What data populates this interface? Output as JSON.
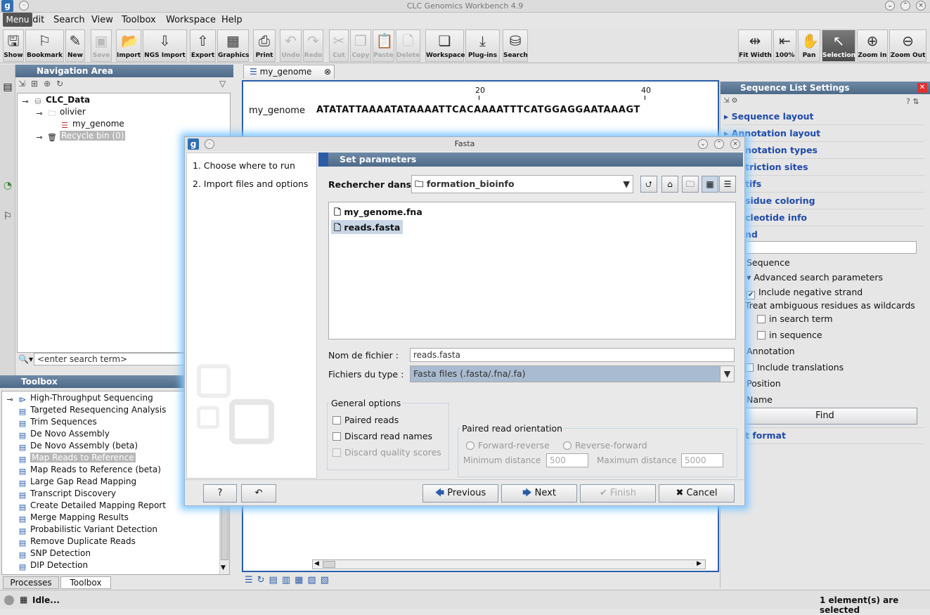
{
  "app": {
    "title": "CLC Genomics Workbench 4.9",
    "logo": "g",
    "menu_tooltip": "Menu"
  },
  "menubar": [
    "Edit",
    "Search",
    "View",
    "Toolbox",
    "Workspace",
    "Help"
  ],
  "toolbar": {
    "left": [
      {
        "label": "Show",
        "icon": "show-icon"
      },
      {
        "label": "Bookmark",
        "icon": "bookmark-icon"
      },
      {
        "label": "New",
        "icon": "new-icon"
      },
      {
        "label": "Save",
        "icon": "save-icon",
        "disabled": true
      },
      {
        "label": "Import",
        "icon": "import-icon"
      },
      {
        "label": "NGS Import",
        "icon": "ngs-import-icon"
      },
      {
        "label": "Export",
        "icon": "export-icon"
      },
      {
        "label": "Graphics",
        "icon": "graphics-icon"
      },
      {
        "label": "Print",
        "icon": "print-icon"
      },
      {
        "label": "Undo",
        "icon": "undo-icon",
        "disabled": true
      },
      {
        "label": "Redo",
        "icon": "redo-icon",
        "disabled": true
      },
      {
        "label": "Cut",
        "icon": "cut-icon",
        "disabled": true
      },
      {
        "label": "Copy",
        "icon": "copy-icon",
        "disabled": true
      },
      {
        "label": "Paste",
        "icon": "paste-icon",
        "disabled": true
      },
      {
        "label": "Delete",
        "icon": "delete-icon",
        "disabled": true
      },
      {
        "label": "Workspace",
        "icon": "workspace-icon"
      },
      {
        "label": "Plug-ins",
        "icon": "plugins-icon"
      },
      {
        "label": "Search",
        "icon": "search-db-icon"
      }
    ],
    "right": [
      {
        "label": "Fit Width",
        "icon": "fit-width-icon"
      },
      {
        "label": "100%",
        "icon": "zoom-100-icon"
      },
      {
        "label": "Pan",
        "icon": "pan-icon"
      },
      {
        "label": "Selection",
        "icon": "selection-icon",
        "selected": true
      },
      {
        "label": "Zoom In",
        "icon": "zoom-in-icon"
      },
      {
        "label": "Zoom Out",
        "icon": "zoom-out-icon"
      }
    ]
  },
  "navigation": {
    "title": "Navigation Area",
    "tree": {
      "root": "CLC_Data",
      "folder": "olivier",
      "item": "my_genome",
      "recycle": "Recycle bin (0)"
    },
    "search_placeholder": "<enter search term>"
  },
  "toolbox": {
    "title": "Toolbox",
    "category": "High-Throughput Sequencing",
    "items": [
      "Targeted Resequencing Analysis",
      "Trim Sequences",
      "De Novo Assembly",
      "De Novo Assembly (beta)",
      "Map Reads to Reference",
      "Map Reads to Reference (beta)",
      "Large Gap Read Mapping",
      "Transcript Discovery",
      "Create Detailed Mapping Report",
      "Merge Mapping Results",
      "Probabilistic Variant Detection",
      "Remove Duplicate Reads",
      "SNP Detection",
      "DIP Detection"
    ],
    "selected_index": 4,
    "bottom_tabs": [
      "Processes",
      "Toolbox"
    ]
  },
  "editor": {
    "tab": "my_genome",
    "ruler": [
      "20",
      "40"
    ],
    "seq_name": "my_genome",
    "sequence": "ATATATTAAAATATAAAATTCACAAAATTTCATGGAGGAATAAAGT"
  },
  "settings": {
    "title": "Sequence List Settings",
    "sections": [
      "Sequence layout",
      "Annotation layout",
      "notation types",
      "triction sites",
      "tifs",
      "sidue coloring",
      "cleotide info"
    ],
    "find_label": "nd",
    "opt_sequence": "Sequence",
    "advanced": "Advanced search parameters",
    "include_negative": "Include negative strand",
    "treat_ambiguous": "Treat ambiguous residues as wildcards",
    "in_search_term": "in search term",
    "in_sequence": "in sequence",
    "opt_annotation": "Annotation",
    "include_translations": "Include translations",
    "opt_position": "Position",
    "opt_name": "Name",
    "find_button": "Find",
    "text_format": "t format"
  },
  "dialog": {
    "title": "Fasta",
    "steps": [
      "1.  Choose where to run",
      "2.  Import files and options"
    ],
    "header": "Set parameters",
    "look_in_label": "Rechercher dans :",
    "look_in_value": "formation_bioinfo",
    "files": [
      "my_genome.fna",
      "reads.fasta"
    ],
    "selected_file": 1,
    "filename_label": "Nom de fichier :",
    "filename_value": "reads.fasta",
    "filetype_label": "Fichiers du type :",
    "filetype_value": "Fasta files (.fasta/.fna/.fa)",
    "general_options": "General options",
    "paired_reads": "Paired reads",
    "discard_read_names": "Discard read names",
    "discard_quality": "Discard quality scores",
    "paired_orientation": "Paired read orientation",
    "forward_reverse": "Forward-reverse",
    "reverse_forward": "Reverse-forward",
    "min_distance_label": "Minimum distance",
    "min_distance": "500",
    "max_distance_label": "Maximum distance",
    "max_distance": "5000",
    "buttons": {
      "help": "?",
      "reset": "↶",
      "previous": "Previous",
      "next": "Next",
      "finish": "Finish",
      "cancel": "Cancel"
    }
  },
  "status": {
    "left": "Idle...",
    "right": "1 element(s) are selected"
  }
}
